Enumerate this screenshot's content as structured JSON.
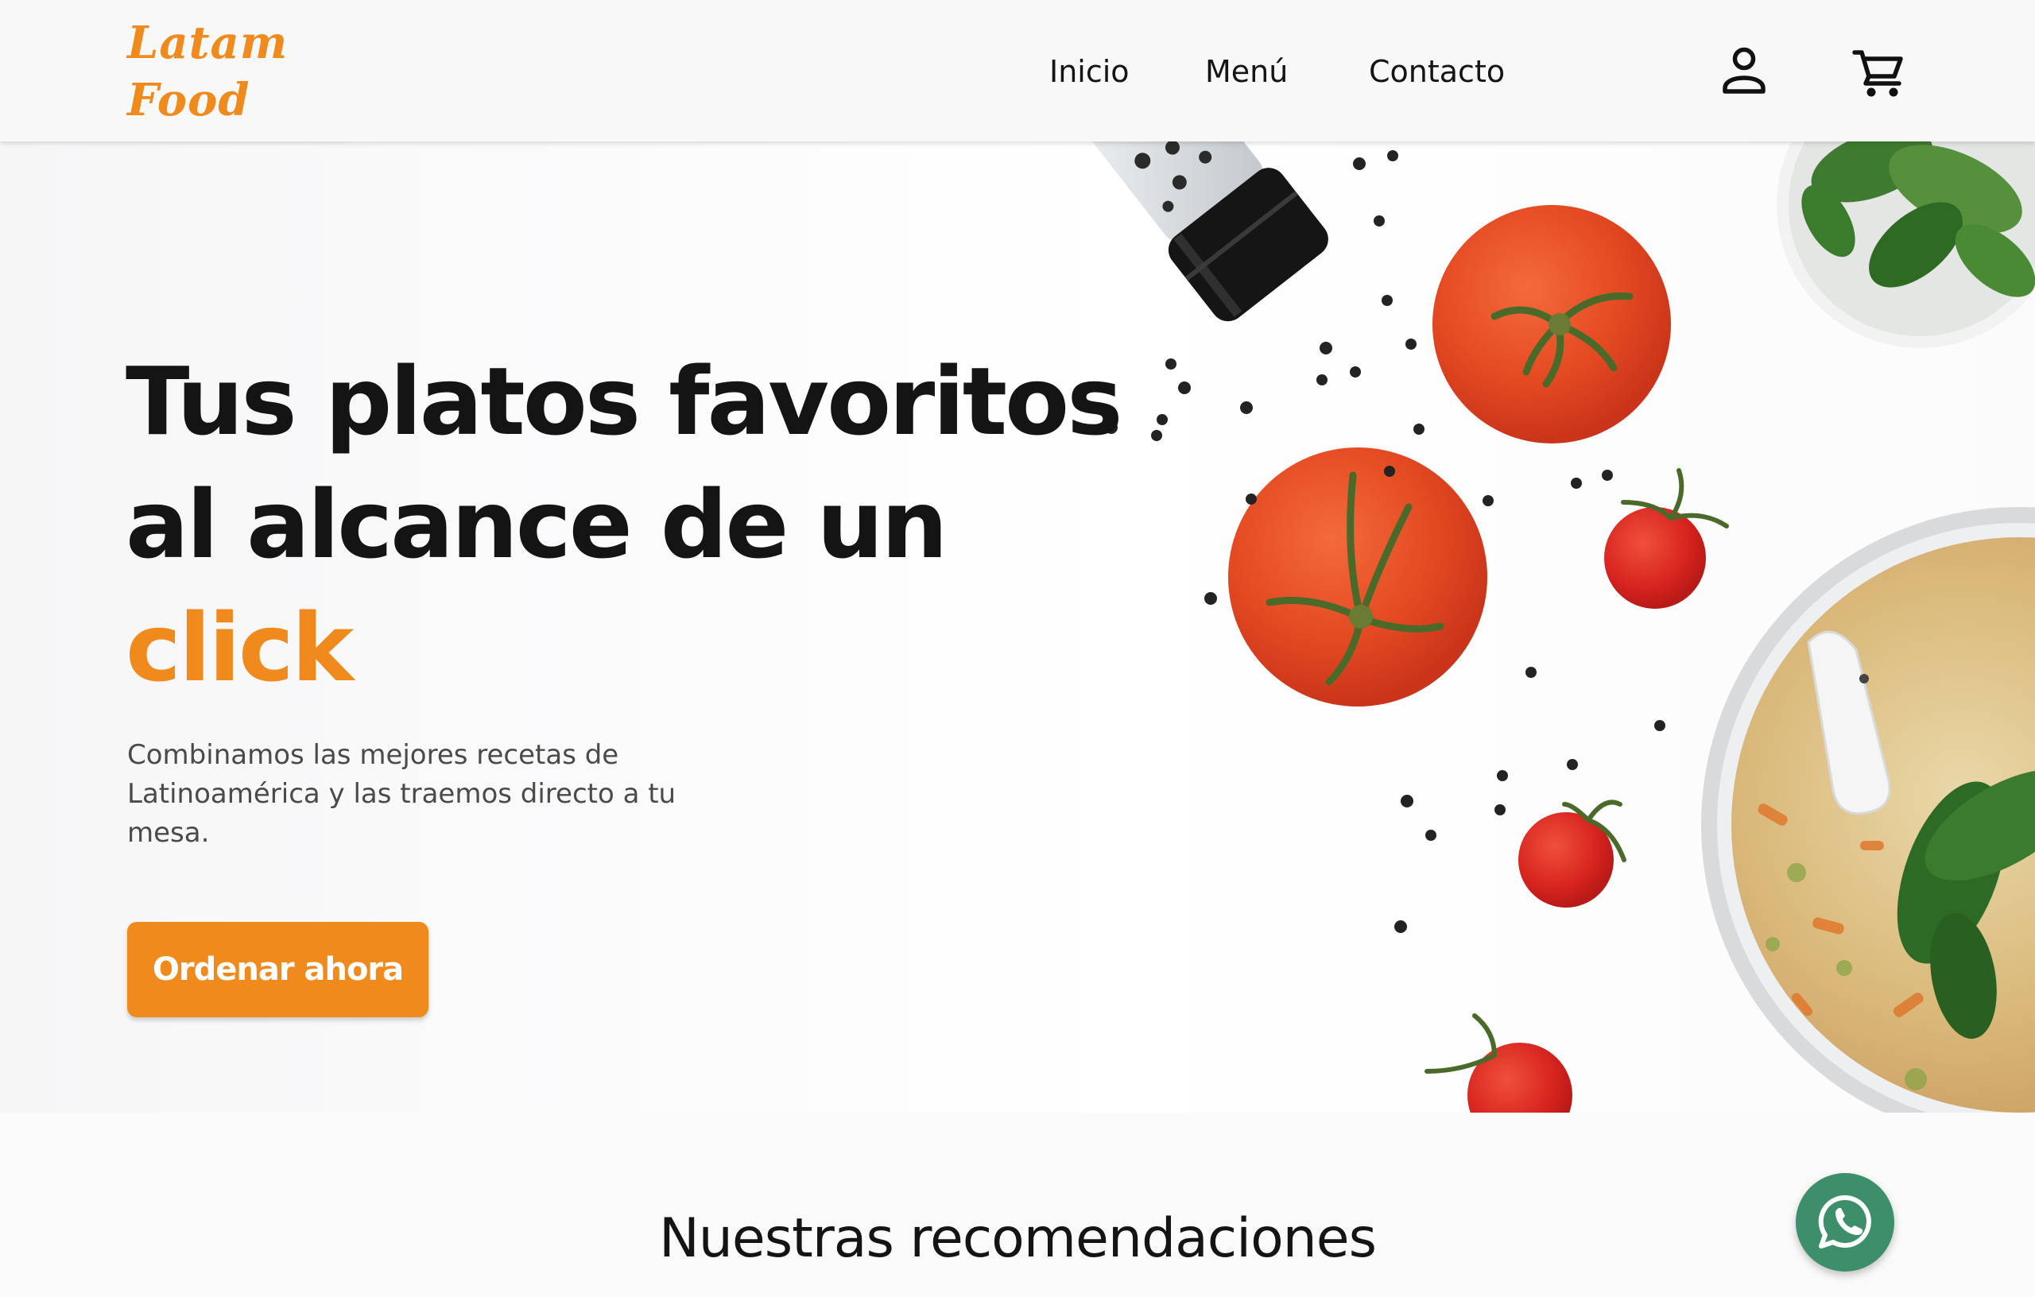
{
  "brand": {
    "line1": "Latam",
    "line2": "Food",
    "color": "#f08a1d"
  },
  "nav": {
    "items": [
      {
        "label": "Inicio"
      },
      {
        "label": "Menú"
      },
      {
        "label": "Contacto"
      }
    ]
  },
  "header_icons": {
    "account": "user-icon",
    "cart": "shopping-cart-icon"
  },
  "hero": {
    "title_line1": "Tus platos favoritos",
    "title_line2": "al alcance de un",
    "title_accent": "click",
    "description": "Combinamos las mejores recetas de Latinoamérica y las traemos directo a tu mesa.",
    "cta_label": "Ordenar ahora",
    "accent_color": "#f08a1d",
    "image_contents": [
      "pepper-grinder",
      "peppercorns",
      "tomatoes",
      "cherry-tomatoes",
      "spinach-bowl",
      "soup-bowl"
    ]
  },
  "recommendations": {
    "title": "Nuestras recomendaciones"
  },
  "whatsapp": {
    "icon": "whatsapp-icon",
    "color": "#3c8f6a"
  }
}
